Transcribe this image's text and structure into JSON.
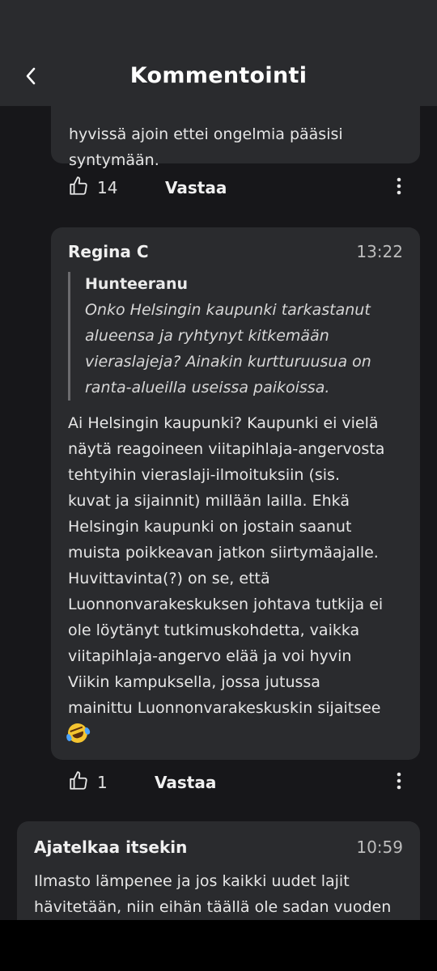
{
  "header": {
    "title": "Kommentointi"
  },
  "first_comment": {
    "text_lines": [
      "hyvissä ajoin  ettei ongelmia pääsisi",
      "syntymään."
    ],
    "likes": "14",
    "reply_label": "Vastaa"
  },
  "reply_comment": {
    "author": "Regina C",
    "time": "13:22",
    "quote": {
      "author": "Hunteeranu",
      "lines": [
        "Onko Helsingin kaupunki tarkastanut",
        "alueensa ja ryhtynyt kitkemään",
        "vieraslajeja? Ainakin kurtturuusua on",
        "ranta-alueilla useissa paikoissa."
      ]
    },
    "body_lines": [
      "Ai Helsingin kaupunki? Kaupunki ei vielä",
      "näytä reagoineen viitapihlaja-angervosta",
      "tehtyihin vieraslaji-ilmoituksiin (sis.",
      "kuvat ja sijainnit) millään lailla. Ehkä",
      "Helsingin kaupunki on  jostain saanut",
      "muista poikkeavan jatkon siirtymäajalle.",
      "Huvittavinta(?) on se, että",
      "Luonnonvarakeskuksen johtava tutkija ei",
      "ole löytänyt tutkimuskohdetta, vaikka",
      "viitapihlaja-angervo elää ja voi hyvin",
      "Viikin kampuksella, jossa jutussa",
      "mainittu Luonnonvarakeskuskin sijaitsee"
    ],
    "emoji": "🤣",
    "likes": "1",
    "reply_label": "Vastaa"
  },
  "third_comment": {
    "author": "Ajatelkaa itsekin",
    "time": "10:59",
    "lines": [
      "Ilmasto lämpenee ja jos kaikki uudet lajit",
      "hävitetään, niin eihän täällä ole sadan vuoden"
    ]
  },
  "colors": {
    "background": "#17171a",
    "card": "#2a2b2e",
    "header": "#2a2b2e"
  },
  "icons": [
    "back-arrow-icon",
    "thumbs-up-icon",
    "more-vertical-icon",
    "rolling-laughing-emoji"
  ]
}
